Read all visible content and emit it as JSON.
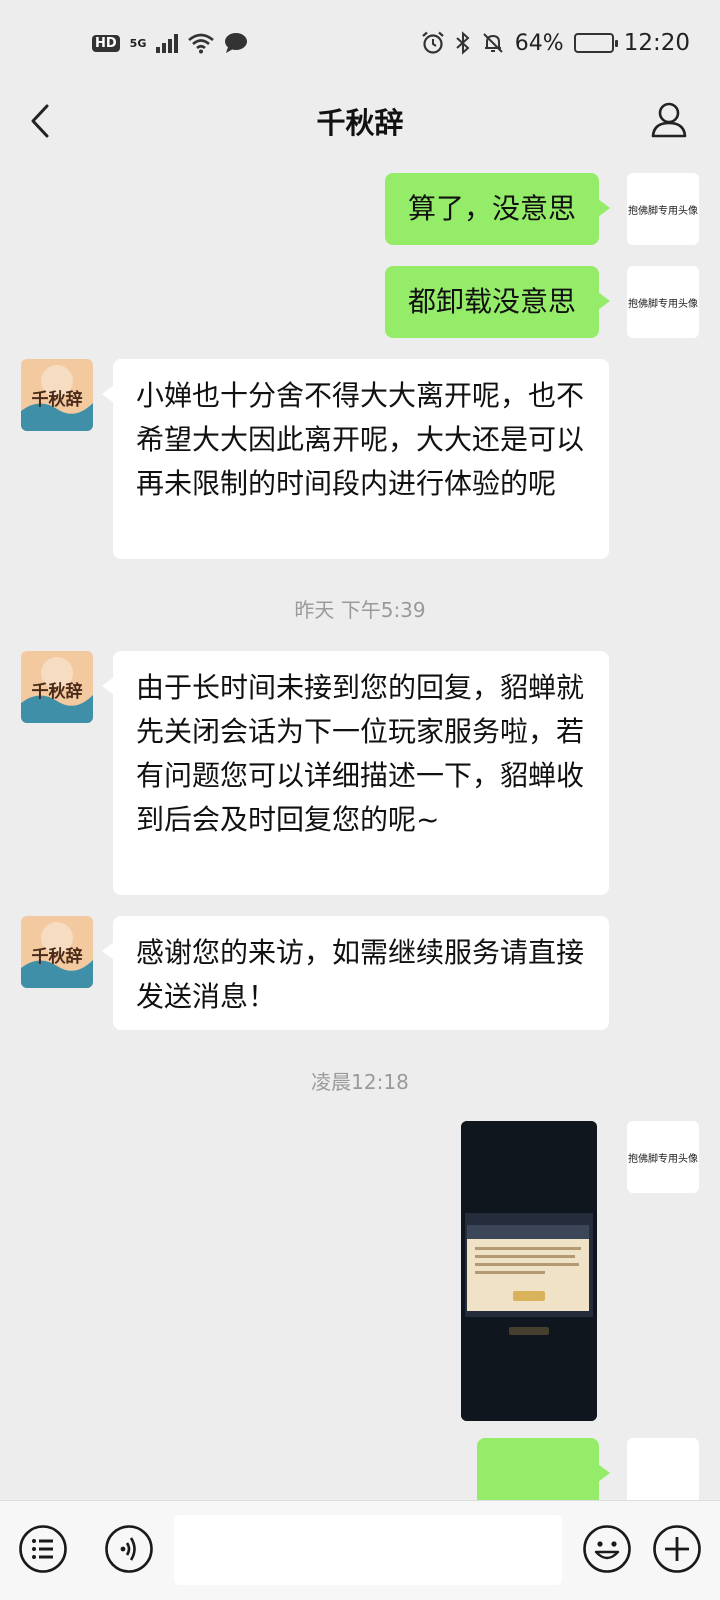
{
  "status_bar": {
    "hd": "HD",
    "network": "5G",
    "battery_text": "64%",
    "battery_level": 0.64,
    "time": "12:20",
    "icons": [
      "signal-icon",
      "wifi-icon",
      "chat-bubble-icon",
      "alarm-icon",
      "bluetooth-icon",
      "mute-bell-icon",
      "battery-icon"
    ]
  },
  "header": {
    "title": "千秋辞",
    "back_icon": "chevron-left-icon",
    "profile_icon": "person-icon"
  },
  "contacts": {
    "self_avatar_text": "抱佛脚专用头像",
    "bot_avatar_text": "千秋辞",
    "bot_avatar_colors": [
      "#f3c9a0",
      "#3f8fa8",
      "#e79a56"
    ]
  },
  "messages": [
    {
      "type": "out",
      "text": "算了，没意思"
    },
    {
      "type": "out",
      "text": "都卸载没意思"
    },
    {
      "type": "in",
      "text": "小婵也十分舍不得大大离开呢，也不希望大大因此离开呢，大大还是可以再未限制的时间段内进行体验的呢"
    },
    {
      "type": "time",
      "text": "昨天 下午5:39"
    },
    {
      "type": "in",
      "text": "由于长时间未接到您的回复，貂蝉就先关闭会话为下一位玩家服务啦，若有问题您可以详细描述一下，貂蝉收到后会及时回复您的呢~"
    },
    {
      "type": "in",
      "text": "感谢您的来访，如需继续服务请直接发送消息！"
    },
    {
      "type": "time",
      "text": "凌晨12:18"
    },
    {
      "type": "out-image",
      "text": ""
    },
    {
      "type": "out",
      "text": ""
    }
  ],
  "input_bar": {
    "voice_icon": "voice-icon",
    "menu_icon": "list-menu-icon",
    "emoji_icon": "emoji-icon",
    "plus_icon": "plus-icon",
    "draft": ""
  },
  "colors": {
    "background": "#ededed",
    "outgoing_bubble": "#95ec69",
    "incoming_bubble": "#ffffff",
    "timestamp": "#9a9a9a"
  }
}
